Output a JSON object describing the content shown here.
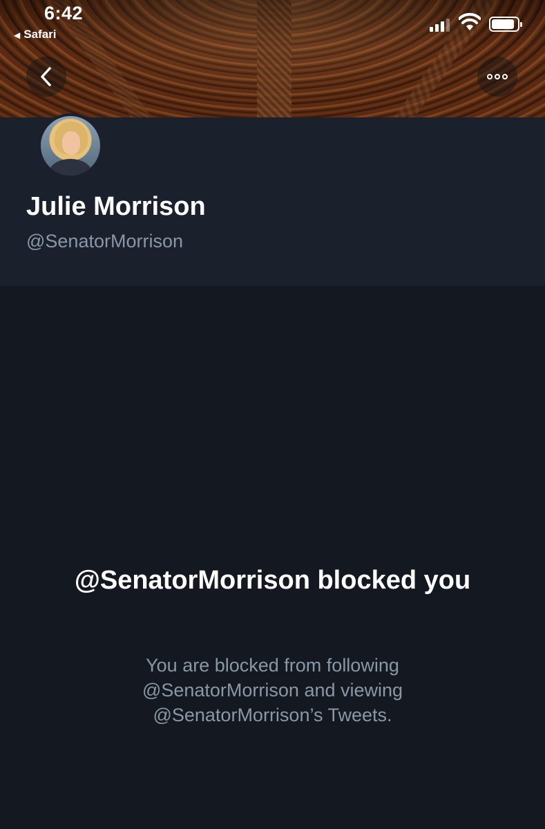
{
  "status_bar": {
    "time": "6:42",
    "back_app": "Safari"
  },
  "profile": {
    "display_name": "Julie Morrison",
    "handle": "@SenatorMorrison"
  },
  "blocked": {
    "title": "@SenatorMorrison blocked you",
    "description": "You are blocked from following @SenatorMorrison and viewing @SenatorMorrison’s Tweets."
  },
  "icons": [
    "back-chevron-icon",
    "more-options-icon",
    "cellular-signal-icon",
    "wifi-icon",
    "battery-icon"
  ],
  "colors": {
    "background": "#141921",
    "header_panel": "#1b212c",
    "secondary_text": "#8a97a5"
  }
}
